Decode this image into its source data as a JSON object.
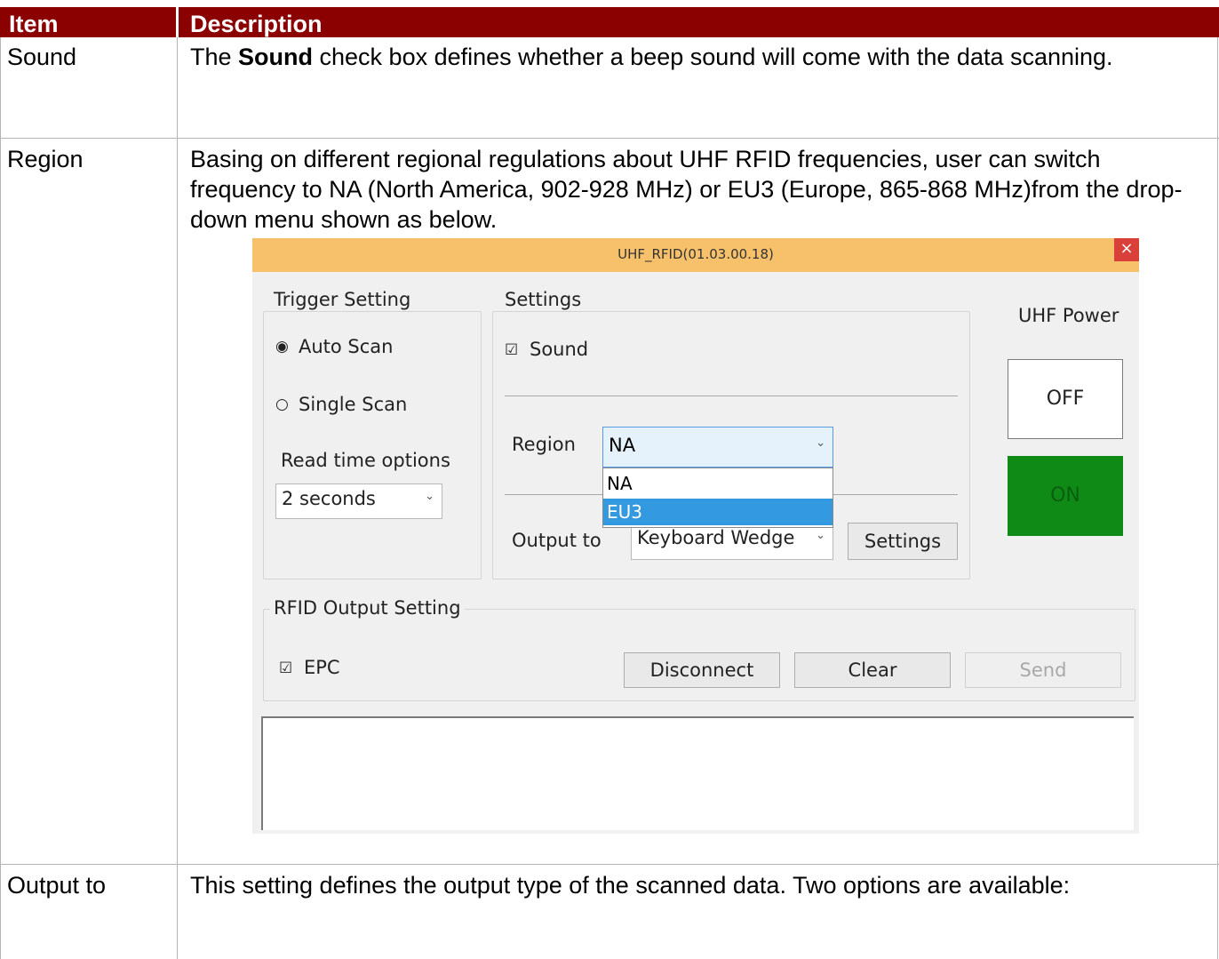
{
  "table": {
    "headers": {
      "item": "Item",
      "description": "Description"
    },
    "rows": [
      {
        "item": "Sound",
        "desc_pre": "The ",
        "desc_bold": "Sound",
        "desc_post": " check box defines whether a beep sound will come with the data scanning."
      },
      {
        "item": "Region",
        "desc": "Basing on different regional regulations about UHF RFID frequencies, user can switch frequency to NA (North America, 902-928 MHz) or EU3 (Europe, 865-868 MHz)from the drop-down menu shown as below."
      },
      {
        "item": "Output to",
        "desc": "This setting defines the output type of the scanned data. Two options are available:"
      }
    ]
  },
  "dialog": {
    "title": "UHF_RFID(01.03.00.18)",
    "close_glyph": "×",
    "trigger": {
      "label": "Trigger Setting",
      "auto_scan": "Auto Scan",
      "single_scan": "Single Scan",
      "read_time_label": "Read time options",
      "read_time_value": "2 seconds"
    },
    "settings": {
      "label": "Settings",
      "sound_label": "Sound",
      "region_label": "Region",
      "region_value": "NA",
      "region_options": [
        "NA",
        "EU3"
      ],
      "region_highlighted": "EU3",
      "output_label": "Output to",
      "output_value": "Keyboard Wedge",
      "settings_button": "Settings"
    },
    "power": {
      "label": "UHF Power",
      "off_button": "OFF",
      "on_button": "ON",
      "on_color": "#0f8a16"
    },
    "rfid_output": {
      "label": "RFID Output Setting",
      "epc_label": "EPC",
      "disconnect_button": "Disconnect",
      "clear_button": "Clear",
      "send_button": "Send"
    }
  },
  "colors": {
    "header_bg": "#8b0000",
    "titlebar_bg": "#f7c16b",
    "highlight": "#3399e1"
  }
}
